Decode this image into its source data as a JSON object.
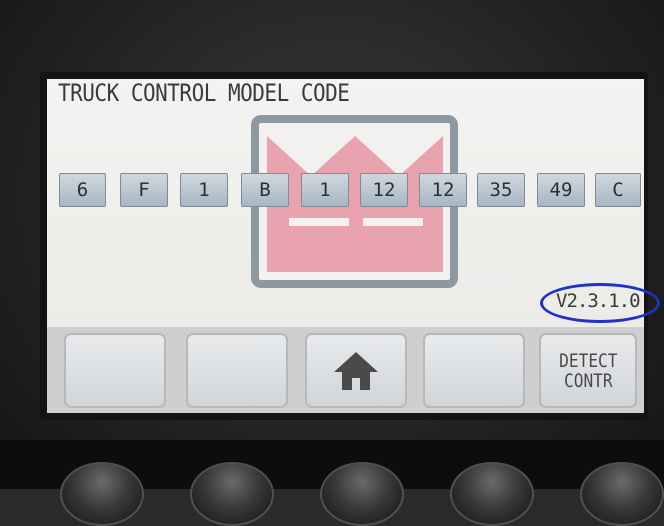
{
  "display": {
    "title": "TRUCK CONTROL MODEL CODE",
    "version": "V2.3.1.0"
  },
  "model_code": [
    "6",
    "F",
    "1",
    "B",
    "1",
    "12",
    "12",
    "35",
    "49",
    "C"
  ],
  "buttons": {
    "b1": "",
    "b2": "",
    "home_icon": "home-icon",
    "b4": "",
    "detect_line1": "DETECT",
    "detect_line2": "CONTR"
  },
  "colors": {
    "crown": "#e8a3ae",
    "frame": "#8d98a3",
    "version_highlight": "#2030c8"
  }
}
